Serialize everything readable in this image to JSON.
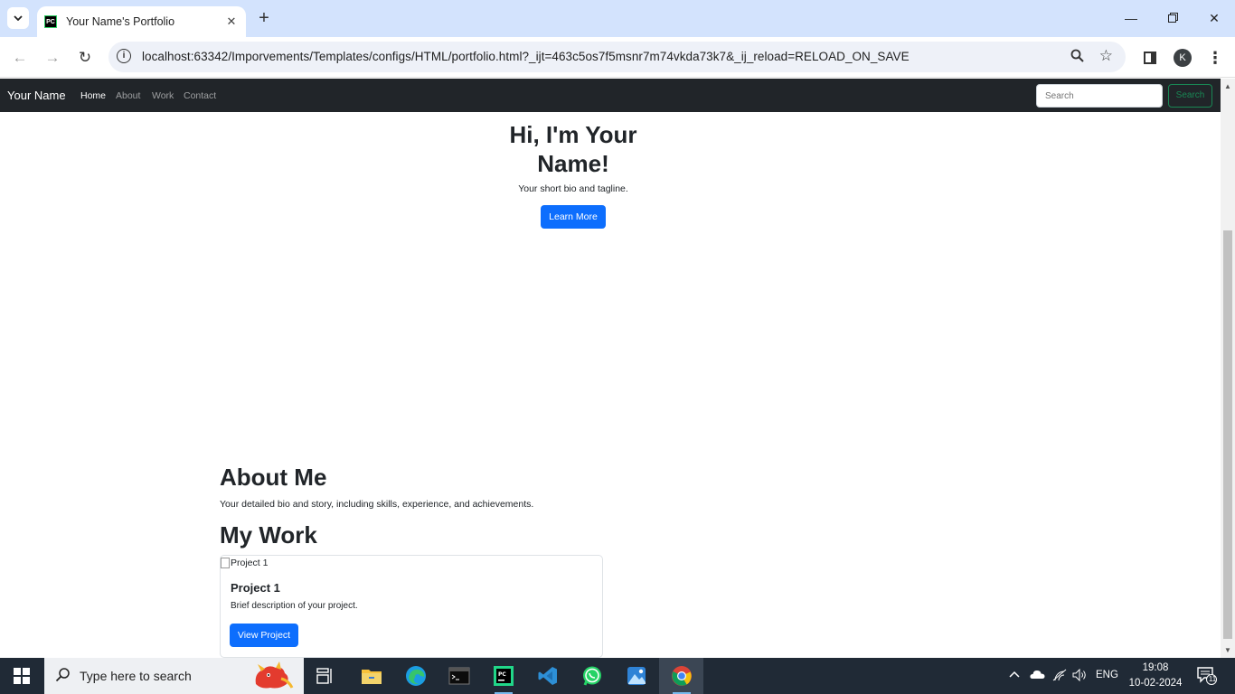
{
  "browser": {
    "tab_title": "Your Name's Portfolio",
    "favicon_text": "PC",
    "url": "localhost:63342/Imporvements/Templates/configs/HTML/portfolio.html?_ijt=463c5os7f5msnr7m74vkda73k7&_ij_reload=RELOAD_ON_SAVE",
    "profile_initial": "K"
  },
  "navbar": {
    "brand": "Your Name",
    "links": [
      "Home",
      "About",
      "Work",
      "Contact"
    ],
    "active_link": "Home",
    "search_placeholder": "Search",
    "search_button": "Search"
  },
  "hero": {
    "title": "Hi, I'm Your Name!",
    "subtitle": "Your short bio and tagline.",
    "button": "Learn More"
  },
  "about": {
    "title": "About Me",
    "text": "Your detailed bio and story, including skills, experience, and achievements."
  },
  "work": {
    "title": "My Work",
    "cards": [
      {
        "image_alt": "Project 1",
        "title": "Project 1",
        "text": "Brief description of your project.",
        "button": "View Project"
      }
    ]
  },
  "taskbar": {
    "search_placeholder": "Type here to search",
    "language": "ENG",
    "time": "19:08",
    "date": "10-02-2024",
    "notification_count": "11"
  },
  "colors": {
    "navbar_bg": "#212529",
    "primary": "#0d6efd",
    "success": "#198754",
    "tabbar_bg": "#d3e3fd",
    "taskbar_bg": "#202a36"
  }
}
